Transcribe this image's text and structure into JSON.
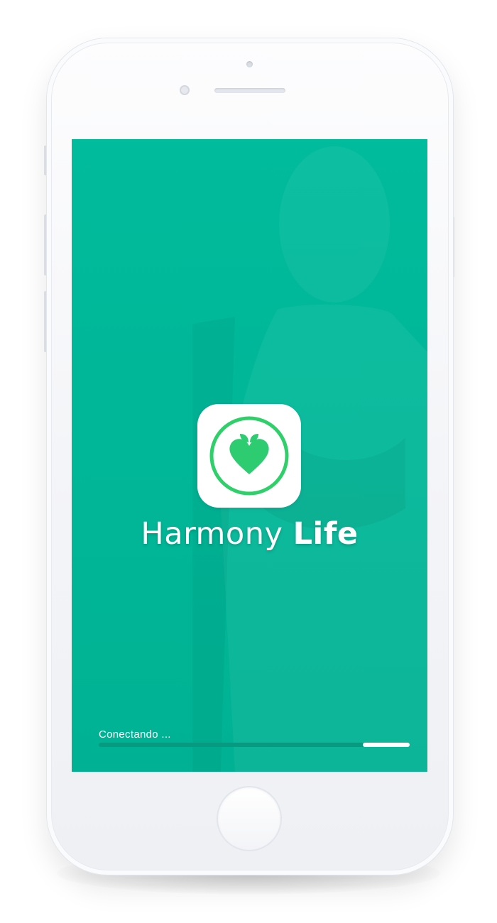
{
  "app": {
    "title_light": "Harmony",
    "title_bold": "Life",
    "icon": "apple-heart-icon"
  },
  "loading": {
    "status_text": "Conectando ...",
    "progress_remaining_fraction": 0.15
  },
  "colors": {
    "screen_background": "#00b797",
    "accent_green": "#2ecc71",
    "progress_track": "#089a80",
    "progress_fill": "#ffffff"
  }
}
